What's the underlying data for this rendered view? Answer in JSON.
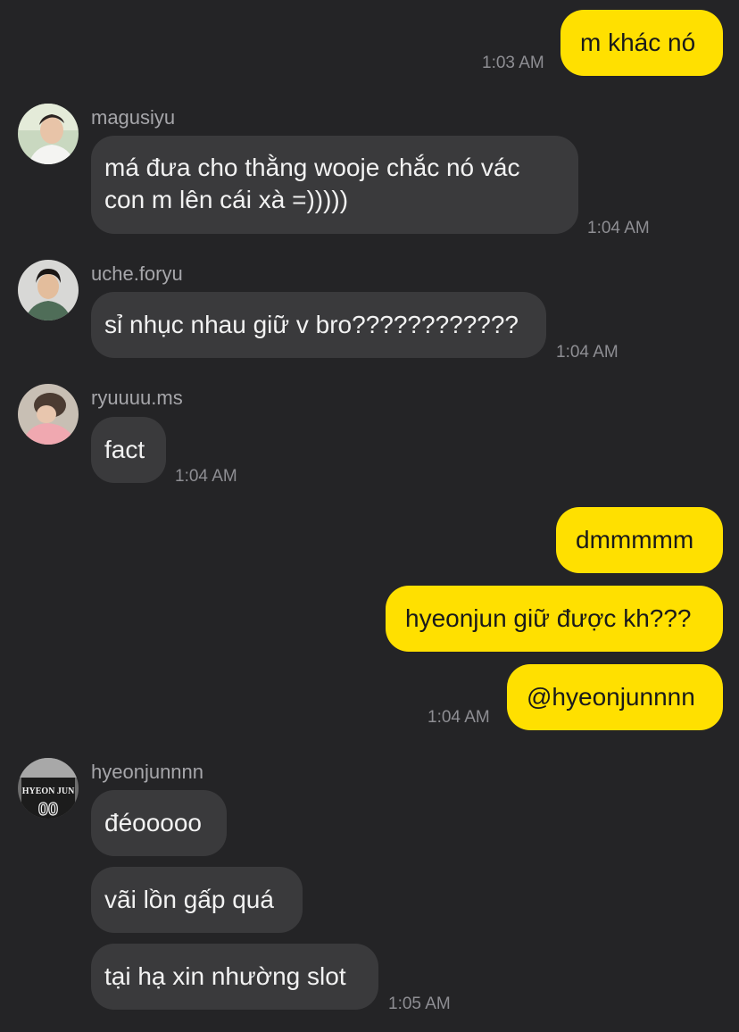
{
  "messages": {
    "m1": {
      "text": "m khác nó",
      "time": "1:03 AM"
    },
    "m2": {
      "sender": "magusiyu",
      "line1": "má đưa cho thằng wooje chắc nó vác",
      "line2": "con m lên cái xà =)))))",
      "time": "1:04 AM"
    },
    "m3": {
      "sender": "uche.foryu",
      "text": "sỉ nhục nhau giữ v bro????????????",
      "time": "1:04 AM"
    },
    "m4": {
      "sender": "ryuuuu.ms",
      "text": "fact",
      "time": "1:04 AM"
    },
    "m5": {
      "text": "dmmmmm"
    },
    "m6": {
      "text": "hyeonjun giữ được kh???"
    },
    "m7": {
      "text": "@hyeonjunnnn",
      "time": "1:04 AM"
    },
    "m8": {
      "sender": "hyeonjunnnn",
      "text": "đéooooo"
    },
    "m9": {
      "text": "vãi lồn gấp quá"
    },
    "m10": {
      "text": "tại hạ xin nhường slot",
      "time": "1:05 AM"
    }
  },
  "avatars": {
    "a_magusiyu": "avatar-magusiyu",
    "a_uche": "avatar-uche",
    "a_ryuuuu": "avatar-ryuuuu",
    "a_hyeonjun": {
      "jersey_text": "HYEON JUN",
      "jersey_number": "00"
    }
  },
  "colors": {
    "background": "#242426",
    "outgoing_bubble": "#ffe000",
    "incoming_bubble": "#3a3a3c",
    "timestamp": "#8e8e93"
  }
}
